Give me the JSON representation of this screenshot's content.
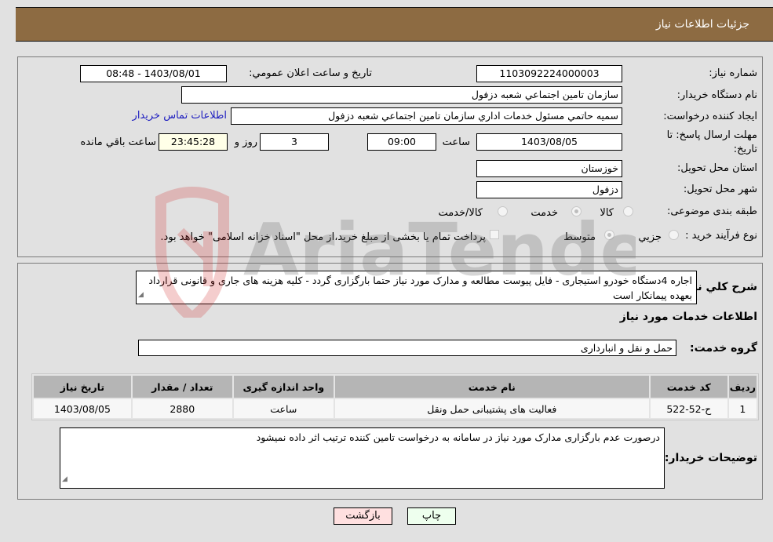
{
  "header": {
    "title": "جزئيات اطلاعات نياز"
  },
  "details": {
    "need_number_label": "شماره نياز:",
    "need_number": "1103092224000003",
    "announce_label": "تاريخ و ساعت اعلان عمومي:",
    "announce_value": "1403/08/01 - 08:48",
    "buyer_org_label": "نام دستگاه خريدار:",
    "buyer_org": "سازمان تامين اجتماعي شعبه دزفول",
    "requester_label": "ايجاد کننده درخواست:",
    "requester": "سميه حاتمي مسئول خدمات اداري سازمان تامين اجتماعي شعبه دزفول",
    "contact_link": "اطلاعات تماس خريدار",
    "deadline_label_line1": "مهلت ارسال پاسخ: تا",
    "deadline_label_line2": "تاريخ:",
    "deadline_date": "1403/08/05",
    "time_label": "ساعت",
    "deadline_time": "09:00",
    "days": "3",
    "days_label": "روز و",
    "remaining_time": "23:45:28",
    "remaining_label": "ساعت باقي مانده",
    "province_label": "استان محل تحويل:",
    "province": "خوزستان",
    "city_label": "شهر محل تحويل:",
    "city": "دزفول",
    "category_label": "طبقه بندی موضوعی:",
    "category_options": [
      "کالا",
      "خدمت",
      "کالا/خدمت"
    ],
    "category_selected": "خدمت",
    "process_label": "نوع فرآيند خريد :",
    "process_options": [
      "جزيي",
      "متوسط"
    ],
    "process_selected": "متوسط",
    "treasury_note": "پرداخت تمام يا بخشی از مبلغ خريد،از محل \"اسناد خزانه اسلامی\" خواهد بود."
  },
  "description": {
    "label": "شرح کلي نياز:",
    "text": "اجاره 4دستگاه خودرو استيجاری - فايل پيوست مطالعه و مدارک مورد نياز حتما بارگزاری گردد - کليه هزينه های جاری و قانونی قرارداد بعهده پيمانکار است"
  },
  "services": {
    "section_title": "اطلاعات خدمات مورد نياز",
    "group_label": "گروه خدمت:",
    "group_value": "حمل و نقل و انبارداری",
    "columns": [
      "رديف",
      "کد خدمت",
      "نام خدمت",
      "واحد اندازه گيری",
      "تعداد / مقدار",
      "تاريخ نياز"
    ],
    "rows": [
      [
        "1",
        "ح-52-522",
        "فعاليت های پشتيبانی حمل ونقل",
        "ساعت",
        "2880",
        "1403/08/05"
      ]
    ]
  },
  "buyer_notes": {
    "label": "توضيحات خريدار:",
    "text": "درصورت عدم بارگزاری مدارک مورد نياز در سامانه  به درخواست تامين کننده ترتيب اثر داده نميشود"
  },
  "buttons": {
    "print": "چاپ",
    "back": "بازگشت"
  },
  "watermark": {
    "text": "AriaTender.neT"
  }
}
